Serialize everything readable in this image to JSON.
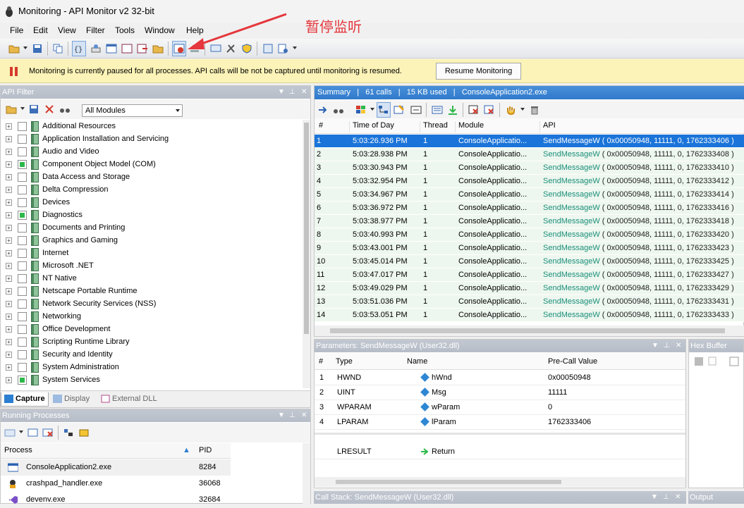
{
  "window": {
    "title": "Monitoring - API Monitor v2 32-bit"
  },
  "menu": [
    "File",
    "Edit",
    "View",
    "Filter",
    "Tools",
    "Window",
    "Help"
  ],
  "annotation": "暂停监听",
  "infobar": {
    "message": "Monitoring is currently paused for all processes. API calls will be not be captured until monitoring is resumed.",
    "button": "Resume Monitoring"
  },
  "api_filter": {
    "title": "API Filter",
    "module_select": "All Modules",
    "items": [
      {
        "label": "Additional Resources",
        "partial": false
      },
      {
        "label": "Application Installation and Servicing",
        "partial": false
      },
      {
        "label": "Audio and Video",
        "partial": false
      },
      {
        "label": "Component Object Model (COM)",
        "partial": true
      },
      {
        "label": "Data Access and Storage",
        "partial": false
      },
      {
        "label": "Delta Compression",
        "partial": false
      },
      {
        "label": "Devices",
        "partial": false
      },
      {
        "label": "Diagnostics",
        "partial": true
      },
      {
        "label": "Documents and Printing",
        "partial": false
      },
      {
        "label": "Graphics and Gaming",
        "partial": false
      },
      {
        "label": "Internet",
        "partial": false
      },
      {
        "label": "Microsoft .NET",
        "partial": false
      },
      {
        "label": "NT Native",
        "partial": false
      },
      {
        "label": "Netscape Portable Runtime",
        "partial": false
      },
      {
        "label": "Network Security Services (NSS)",
        "partial": false
      },
      {
        "label": "Networking",
        "partial": false
      },
      {
        "label": "Office Development",
        "partial": false
      },
      {
        "label": "Scripting Runtime Library",
        "partial": false
      },
      {
        "label": "Security and Identity",
        "partial": false
      },
      {
        "label": "System Administration",
        "partial": false
      },
      {
        "label": "System Services",
        "partial": true
      }
    ],
    "tabs": [
      "Capture",
      "Display",
      "External DLL"
    ]
  },
  "running_processes": {
    "title": "Running Processes",
    "col_process": "Process",
    "col_pid": "PID",
    "rows": [
      {
        "name": "ConsoleApplication2.exe",
        "pid": "8284"
      },
      {
        "name": "crashpad_handler.exe",
        "pid": "36068"
      },
      {
        "name": "devenv.exe",
        "pid": "32684"
      }
    ]
  },
  "summary": {
    "title_parts": [
      "Summary",
      "61 calls",
      "15 KB used",
      "ConsoleApplication2.exe"
    ],
    "columns": [
      "#",
      "Time of Day",
      "Thread",
      "Module",
      "API"
    ],
    "rows": [
      {
        "n": "1",
        "time": "5:03:26.936 PM",
        "thread": "1",
        "module": "ConsoleApplicatio...",
        "api": "SendMessageW",
        "args": " ( 0x00050948, 11111, 0, 1762333406 )"
      },
      {
        "n": "2",
        "time": "5:03:28.938 PM",
        "thread": "1",
        "module": "ConsoleApplicatio...",
        "api": "SendMessageW",
        "args": " ( 0x00050948, 11111, 0, 1762333408 )"
      },
      {
        "n": "3",
        "time": "5:03:30.943 PM",
        "thread": "1",
        "module": "ConsoleApplicatio...",
        "api": "SendMessageW",
        "args": " ( 0x00050948, 11111, 0, 1762333410 )"
      },
      {
        "n": "4",
        "time": "5:03:32.954 PM",
        "thread": "1",
        "module": "ConsoleApplicatio...",
        "api": "SendMessageW",
        "args": " ( 0x00050948, 11111, 0, 1762333412 )"
      },
      {
        "n": "5",
        "time": "5:03:34.967 PM",
        "thread": "1",
        "module": "ConsoleApplicatio...",
        "api": "SendMessageW",
        "args": " ( 0x00050948, 11111, 0, 1762333414 )"
      },
      {
        "n": "6",
        "time": "5:03:36.972 PM",
        "thread": "1",
        "module": "ConsoleApplicatio...",
        "api": "SendMessageW",
        "args": " ( 0x00050948, 11111, 0, 1762333416 )"
      },
      {
        "n": "7",
        "time": "5:03:38.977 PM",
        "thread": "1",
        "module": "ConsoleApplicatio...",
        "api": "SendMessageW",
        "args": " ( 0x00050948, 11111, 0, 1762333418 )"
      },
      {
        "n": "8",
        "time": "5:03:40.993 PM",
        "thread": "1",
        "module": "ConsoleApplicatio...",
        "api": "SendMessageW",
        "args": " ( 0x00050948, 11111, 0, 1762333420 )"
      },
      {
        "n": "9",
        "time": "5:03:43.001 PM",
        "thread": "1",
        "module": "ConsoleApplicatio...",
        "api": "SendMessageW",
        "args": " ( 0x00050948, 11111, 0, 1762333423 )"
      },
      {
        "n": "10",
        "time": "5:03:45.014 PM",
        "thread": "1",
        "module": "ConsoleApplicatio...",
        "api": "SendMessageW",
        "args": " ( 0x00050948, 11111, 0, 1762333425 )"
      },
      {
        "n": "11",
        "time": "5:03:47.017 PM",
        "thread": "1",
        "module": "ConsoleApplicatio...",
        "api": "SendMessageW",
        "args": " ( 0x00050948, 11111, 0, 1762333427 )"
      },
      {
        "n": "12",
        "time": "5:03:49.029 PM",
        "thread": "1",
        "module": "ConsoleApplicatio...",
        "api": "SendMessageW",
        "args": " ( 0x00050948, 11111, 0, 1762333429 )"
      },
      {
        "n": "13",
        "time": "5:03:51.036 PM",
        "thread": "1",
        "module": "ConsoleApplicatio...",
        "api": "SendMessageW",
        "args": " ( 0x00050948, 11111, 0, 1762333431 )"
      },
      {
        "n": "14",
        "time": "5:03:53.051 PM",
        "thread": "1",
        "module": "ConsoleApplicatio...",
        "api": "SendMessageW",
        "args": " ( 0x00050948, 11111, 0, 1762333433 )"
      }
    ]
  },
  "parameters": {
    "title": "Parameters: SendMessageW (User32.dll)",
    "columns": [
      "#",
      "Type",
      "Name",
      "Pre-Call Value"
    ],
    "rows": [
      {
        "n": "1",
        "type": "HWND",
        "name": "hWnd",
        "value": "0x00050948"
      },
      {
        "n": "2",
        "type": "UINT",
        "name": "Msg",
        "value": "11111"
      },
      {
        "n": "3",
        "type": "WPARAM",
        "name": "wParam",
        "value": "0"
      },
      {
        "n": "4",
        "type": "LPARAM",
        "name": "lParam",
        "value": "1762333406"
      }
    ],
    "return_type": "LRESULT",
    "return_name": "Return"
  },
  "callstack": {
    "title": "Call Stack: SendMessageW (User32.dll)"
  },
  "hexbuffer": {
    "title": "Hex Buffer"
  },
  "output": {
    "title": "Output"
  },
  "colors": {
    "accent": "#2f7acb",
    "selected_row": "#1a74d9",
    "pause_icon": "#d53b2c",
    "infobar_bg": "#fbf3b7",
    "api_text": "#1b8f7a",
    "annotation": "#e5373d"
  }
}
